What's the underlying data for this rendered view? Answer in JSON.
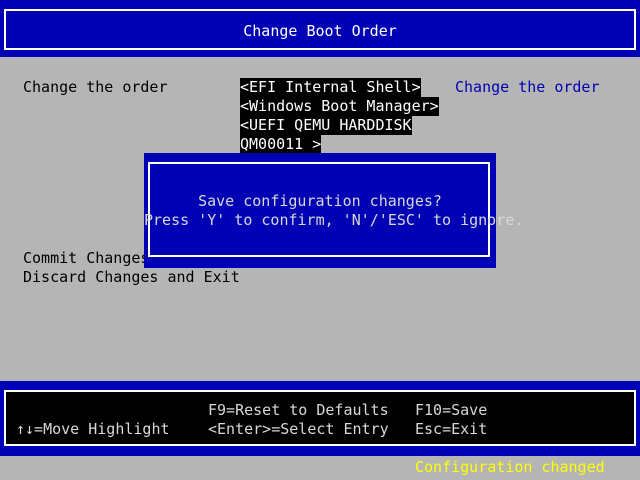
{
  "header": {
    "title": "Change Boot Order"
  },
  "main": {
    "change_order_label": "Change the order",
    "help_text": "Change the order",
    "boot_order": [
      "<EFI Internal Shell>",
      "<Windows Boot Manager>",
      "<UEFI QEMU HARDDISK",
      "QM00011 >"
    ],
    "commit_label": "Commit Changes",
    "discard_label": "Discard Changes and Exit"
  },
  "dialog": {
    "line1": "Save configuration changes?",
    "line2": "Press 'Y' to confirm, 'N'/'ESC' to ignore."
  },
  "footer": {
    "f9": "F9=Reset to Defaults",
    "f10": "F10=Save",
    "move": "↑↓=Move Highlight",
    "enter": "<Enter>=Select Entry",
    "esc": "Esc=Exit"
  },
  "status": "Configuration changed",
  "colors": {
    "background": "#b5b5b5",
    "bios_blue": "#0000b4",
    "highlight": "#000000",
    "status_yellow": "#ffff00"
  }
}
